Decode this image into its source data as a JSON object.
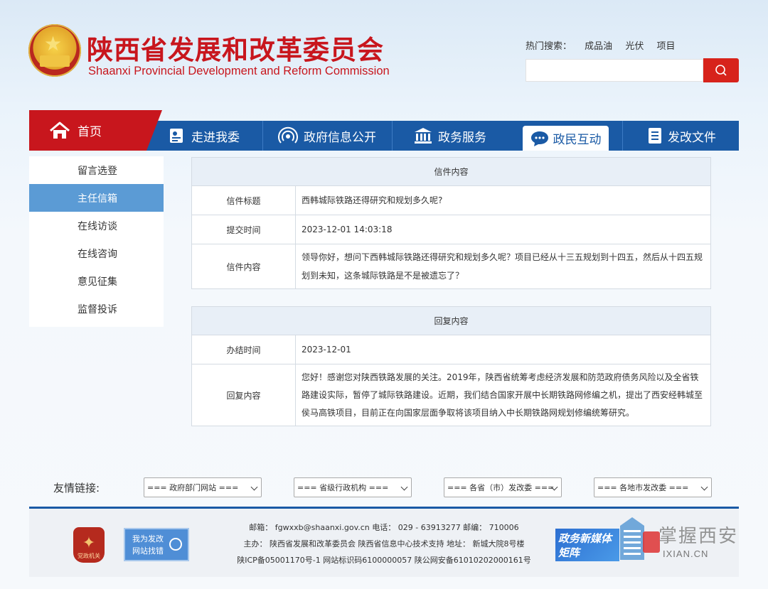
{
  "header": {
    "title_cn": "陕西省发展和改革委员会",
    "title_en": "Shaanxi Provincial Development and Reform Commission",
    "hot_search_label": "热门搜索：",
    "hot_search_terms": [
      "成品油",
      "光伏",
      "项目"
    ]
  },
  "nav": {
    "home": "首页",
    "items": [
      "走进我委",
      "政府信息公开",
      "政务服务",
      "政民互动",
      "发改文件"
    ]
  },
  "sidebar": {
    "items": [
      "留言选登",
      "主任信箱",
      "在线访谈",
      "在线咨询",
      "意见征集",
      "监督投诉"
    ],
    "active_index": 1
  },
  "letter": {
    "heading": "信件内容",
    "rows": [
      {
        "label": "信件标题",
        "value": "西韩城际铁路还得研究和规划多久呢?"
      },
      {
        "label": "提交时间",
        "value": "2023-12-01 14:03:18"
      },
      {
        "label": "信件内容",
        "value": "领导你好，想问下西韩城际铁路还得研究和规划多久呢？项目已经从十三五规划到十四五，然后从十四五规划到未知，这条城际铁路是不是被遗忘了？"
      }
    ]
  },
  "reply": {
    "heading": "回复内容",
    "rows": [
      {
        "label": "办结时间",
        "value": "2023-12-01"
      },
      {
        "label": "回复内容",
        "value": "您好！感谢您对陕西铁路发展的关注。2019年，陕西省统筹考虑经济发展和防范政府债务风险以及全省铁路建设实际，暂停了城际铁路建设。近期，我们结合国家开展中长期铁路网修编之机，提出了西安经韩城至侯马高铁项目，目前正在向国家层面争取将该项目纳入中长期铁路网规划修编统筹研究。"
      }
    ]
  },
  "links": {
    "label": "友情链接:",
    "selects": [
      "=== 政府部门网站 ===",
      "=== 省级行政机构 ===",
      "=== 各省（市）发改委 ===",
      "=== 各地市发改委 ==="
    ]
  },
  "footer": {
    "line1": "邮箱： fgwxxb@shaanxi.gov.cn      电话： 029 - 63913277      邮编： 710006",
    "line2": "主办： 陕西省发展和改革委员会      陕西省信息中心技术支持      地址： 新城大院8号楼",
    "line3": "陕ICP备05001170号-1 网站标识码6100000057      陕公网安备61010202000161号",
    "badge_red_text": "党政机关",
    "badge_blue_line1": "我为发改",
    "badge_blue_line2": "网站找错",
    "media_line1": "政务新媒体",
    "media_line2": "矩阵"
  },
  "watermark": {
    "cn": "掌握西安",
    "en": "IXIAN.CN"
  },
  "colors": {
    "brand_red": "#c8161d",
    "nav_blue": "#1a5aa5",
    "sidebar_active": "#5b9bd5"
  }
}
